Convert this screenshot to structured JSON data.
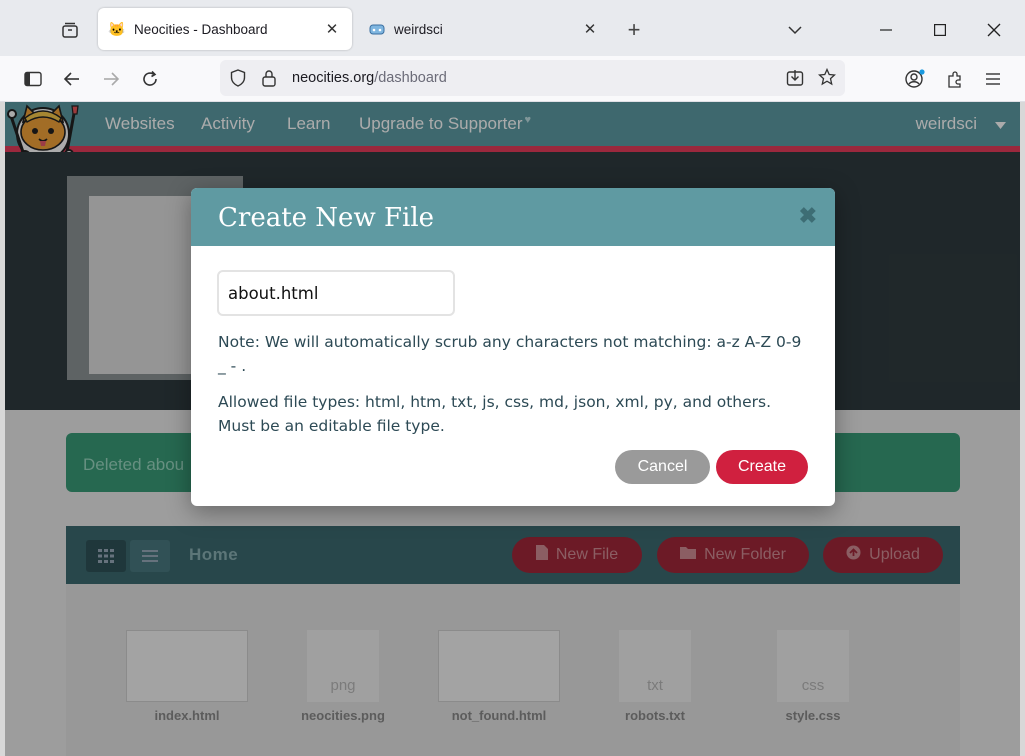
{
  "browser": {
    "tabs": [
      {
        "title": "Neocities - Dashboard",
        "favicon": "cat-icon",
        "active": true
      },
      {
        "title": "weirdsci",
        "favicon": "cloud-icon",
        "active": false
      }
    ],
    "url_host": "neocities.org",
    "url_path": "/dashboard"
  },
  "site": {
    "nav": {
      "websites": "Websites",
      "activity": "Activity",
      "learn": "Learn",
      "upgrade": "Upgrade to Supporter",
      "heart": "♥"
    },
    "username": "weirdsci",
    "alert_text": "Deleted abou",
    "toolbar": {
      "home_label": "Home",
      "new_file": "New File",
      "new_folder": "New Folder",
      "upload": "Upload"
    },
    "files": [
      {
        "name": "index.html",
        "type": "html",
        "ext": ""
      },
      {
        "name": "neocities.png",
        "type": "image",
        "ext": "png"
      },
      {
        "name": "not_found.html",
        "type": "html",
        "ext": ""
      },
      {
        "name": "robots.txt",
        "type": "text",
        "ext": "txt"
      },
      {
        "name": "style.css",
        "type": "text",
        "ext": "css"
      }
    ]
  },
  "modal": {
    "title": "Create New File",
    "close_glyph": "✖",
    "filename_value": "about.html",
    "note": "Note: We will automatically scrub any characters not matching: a-z A-Z 0-9 _ - .",
    "allowed": "Allowed file types: html, htm, txt, js, css, md, json, xml, py, and others. Must be an editable file type.",
    "cancel_label": "Cancel",
    "create_label": "Create"
  },
  "colors": {
    "site_header": "#5d9ca4",
    "accent_red": "#d0203f",
    "modal_header": "#5f9aa2"
  }
}
